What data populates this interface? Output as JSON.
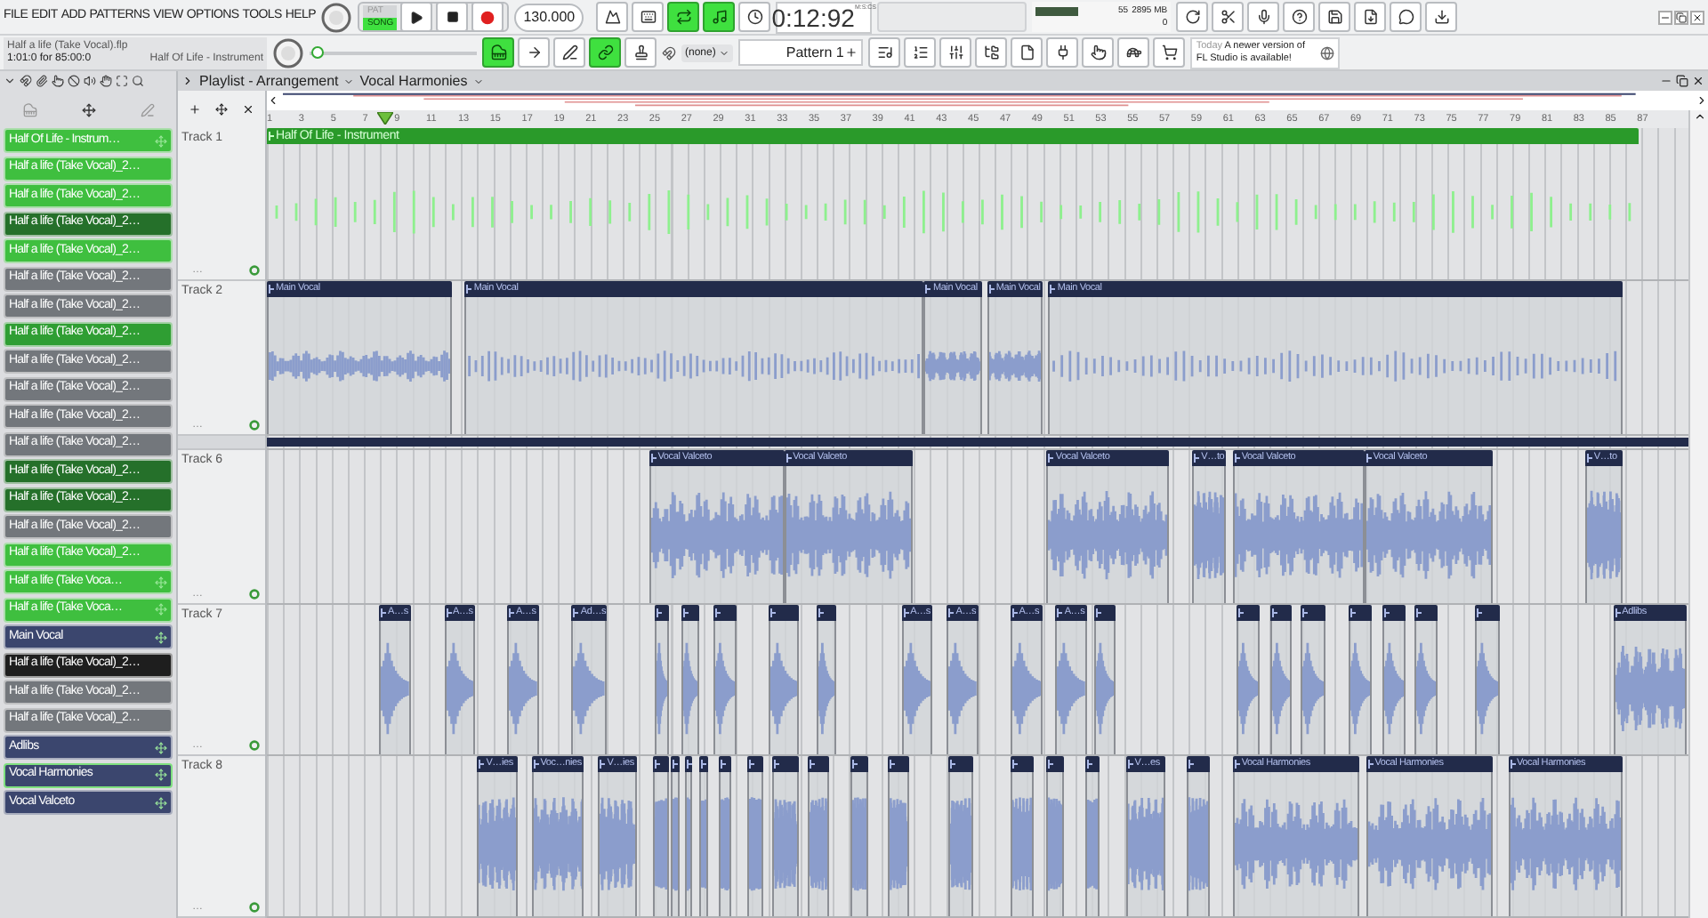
{
  "menu": [
    "FILE",
    "EDIT",
    "ADD",
    "PATTERNS",
    "VIEW",
    "OPTIONS",
    "TOOLS",
    "HELP"
  ],
  "modes": [
    {
      "label": "PAT",
      "selected": false
    },
    {
      "label": "SONG",
      "selected": true
    }
  ],
  "tempo": "130.000",
  "time": "0:12:92",
  "time_unit": "M:S:CS",
  "cpu": "55",
  "memory": "2895 MB",
  "polyphony": "0",
  "toggles_top": [
    {
      "on": false
    },
    {
      "on": false
    },
    {
      "on": true
    },
    {
      "on": true
    },
    {
      "on": false
    }
  ],
  "toggles_bottom": [
    {
      "on": true
    },
    {
      "on": false
    },
    {
      "on": false
    },
    {
      "on": true
    },
    {
      "on": false
    }
  ],
  "project": {
    "file": "Half a life (Take Vocal).flp",
    "position": "1:01:0 for 85:00:0",
    "hint": "Half Of Life - Instrument"
  },
  "position_slider": {
    "level": 0.02
  },
  "snap": "(none)",
  "pattern": "Pattern 1",
  "news": {
    "date": "Today",
    "text": "A newer version of FL Studio is available!"
  },
  "playlist": {
    "title": "Playlist - Arrangement",
    "pattern": "Vocal Harmonies"
  },
  "ruler": [
    "1",
    "3",
    "5",
    "7",
    "9",
    "11",
    "13",
    "15",
    "17",
    "19",
    "21",
    "23",
    "25",
    "27",
    "29",
    "31",
    "33",
    "35",
    "37",
    "39",
    "41",
    "43",
    "45",
    "47",
    "49",
    "51",
    "53",
    "55",
    "57",
    "59",
    "61",
    "63",
    "65",
    "67",
    "69",
    "71",
    "73",
    "75",
    "77",
    "79",
    "81",
    "83",
    "85",
    "87"
  ],
  "channels": [
    {
      "name": "Half Of Life - Instrum…",
      "color": "#3fbf3f",
      "move_icon": true,
      "selected": false
    },
    {
      "name": "Half a life (Take Vocal)_2…",
      "color": "#3fbf3f",
      "move_icon": false,
      "selected": false
    },
    {
      "name": "Half a life (Take Vocal)_2…",
      "color": "#3fbf3f",
      "move_icon": false,
      "selected": false
    },
    {
      "name": "Half a life (Take Vocal)_2…",
      "color": "#25702a",
      "move_icon": false,
      "selected": false
    },
    {
      "name": "Half a life (Take Vocal)_2…",
      "color": "#3fbf3f",
      "move_icon": false,
      "selected": false
    },
    {
      "name": "Half a life (Take Vocal)_2…",
      "color": "#73777c",
      "move_icon": false,
      "selected": false
    },
    {
      "name": "Half a life (Take Vocal)_2…",
      "color": "#73777c",
      "move_icon": false,
      "selected": false
    },
    {
      "name": "Half a life (Take Vocal)_2…",
      "color": "#2f9e33",
      "move_icon": false,
      "selected": false
    },
    {
      "name": "Half a life (Take Vocal)_2…",
      "color": "#73777c",
      "move_icon": false,
      "selected": false
    },
    {
      "name": "Half a life (Take Vocal)_2…",
      "color": "#73777c",
      "move_icon": false,
      "selected": false
    },
    {
      "name": "Half a life (Take Vocal)_2…",
      "color": "#73777c",
      "move_icon": false,
      "selected": false
    },
    {
      "name": "Half a life (Take Vocal)_2…",
      "color": "#73777c",
      "move_icon": false,
      "selected": false
    },
    {
      "name": "Half a life (Take Vocal)_2…",
      "color": "#25702a",
      "move_icon": false,
      "selected": false
    },
    {
      "name": "Half a life (Take Vocal)_2…",
      "color": "#25702a",
      "move_icon": false,
      "selected": false
    },
    {
      "name": "Half a life (Take Vocal)_2…",
      "color": "#73777c",
      "move_icon": false,
      "selected": false
    },
    {
      "name": "Half a life (Take Vocal)_2…",
      "color": "#3fbf3f",
      "move_icon": false,
      "selected": false
    },
    {
      "name": "Half a life (Take Voca…",
      "color": "#3fbf3f",
      "move_icon": true,
      "selected": false
    },
    {
      "name": "Half a life (Take Voca…",
      "color": "#3fbf3f",
      "move_icon": true,
      "selected": false
    },
    {
      "name": "Main Vocal",
      "color": "#3b466e",
      "move_icon": true,
      "selected": false
    },
    {
      "name": "Half a life (Take Vocal)_2…",
      "color": "#1e1e1e",
      "move_icon": false,
      "selected": false
    },
    {
      "name": "Half a life (Take Vocal)_2…",
      "color": "#73777c",
      "move_icon": false,
      "selected": false
    },
    {
      "name": "Half a life (Take Vocal)_2…",
      "color": "#73777c",
      "move_icon": false,
      "selected": false
    },
    {
      "name": "Adlibs",
      "color": "#3b466e",
      "move_icon": true,
      "selected": false
    },
    {
      "name": "Vocal Harmonies",
      "color": "#3b466e",
      "move_icon": true,
      "selected": true
    },
    {
      "name": "Vocal Valceto",
      "color": "#3b466e",
      "move_icon": true,
      "selected": false
    }
  ],
  "tracks": [
    {
      "kind": "track",
      "name": "Track 1",
      "more": "…",
      "color": "#2a9a2a",
      "clips": [
        {
          "kind": "named",
          "label": "Half Of Life - Instrument"
        }
      ]
    },
    {
      "kind": "track",
      "name": "Track 2",
      "more": "…",
      "color": "#222b4a",
      "clips": [
        {
          "kind": "named",
          "label": "Main Vocal"
        },
        {
          "kind": "named",
          "label": "Main Vocal"
        },
        {
          "kind": "named",
          "label": "Main Vocal"
        },
        {
          "kind": "named",
          "label": "Main Vocal"
        },
        {
          "kind": "named",
          "label": "Main Vocal"
        }
      ]
    },
    {
      "kind": "collapsed",
      "color": "#222b4a"
    },
    {
      "kind": "track",
      "name": "Track 6",
      "more": "…",
      "color": "#222b4a",
      "clips": [
        {
          "kind": "named",
          "label": "Vocal Valceto"
        },
        {
          "kind": "named",
          "label": "Vocal Valceto"
        },
        {
          "kind": "named",
          "label": "Vocal Valceto"
        },
        {
          "kind": "named",
          "label": "V…to"
        },
        {
          "kind": "named",
          "label": "Vocal Valceto"
        },
        {
          "kind": "named",
          "label": "Vocal Valceto"
        },
        {
          "kind": "named",
          "label": "V…to"
        }
      ]
    },
    {
      "kind": "track",
      "name": "Track 7",
      "more": "…",
      "color": "#222b4a",
      "clips": [
        {
          "kind": "named",
          "label": "A…s"
        },
        {
          "kind": "named",
          "label": "A…s"
        },
        {
          "kind": "named",
          "label": "A…s"
        },
        {
          "kind": "named",
          "label": "Ad…s"
        },
        {
          "kind": "plain"
        },
        {
          "kind": "plain"
        },
        {
          "kind": "plain"
        },
        {
          "kind": "plain"
        },
        {
          "kind": "plain"
        },
        {
          "kind": "named",
          "label": "A…s"
        },
        {
          "kind": "named",
          "label": "A…s"
        },
        {
          "kind": "named",
          "label": "A…s"
        },
        {
          "kind": "named",
          "label": "A…s"
        },
        {
          "kind": "plain"
        },
        {
          "kind": "plain"
        },
        {
          "kind": "plain"
        },
        {
          "kind": "plain"
        },
        {
          "kind": "plain"
        },
        {
          "kind": "plain"
        },
        {
          "kind": "plain"
        },
        {
          "kind": "plain"
        },
        {
          "kind": "named",
          "label": "Adlibs"
        }
      ]
    },
    {
      "kind": "track",
      "name": "Track 8",
      "more": "…",
      "color": "#222b4a",
      "clips": [
        {
          "kind": "named",
          "label": "V…ies"
        },
        {
          "kind": "named",
          "label": "Voc…nies"
        },
        {
          "kind": "named",
          "label": "V…ies"
        },
        {
          "kind": "plain"
        },
        {
          "kind": "plain"
        },
        {
          "kind": "plain"
        },
        {
          "kind": "plain"
        },
        {
          "kind": "plain"
        },
        {
          "kind": "plain"
        },
        {
          "kind": "plain"
        },
        {
          "kind": "plain"
        },
        {
          "kind": "plain"
        },
        {
          "kind": "plain"
        },
        {
          "kind": "plain"
        },
        {
          "kind": "plain"
        },
        {
          "kind": "plain"
        },
        {
          "kind": "plain"
        },
        {
          "kind": "named",
          "label": "V…es"
        },
        {
          "kind": "plain"
        },
        {
          "kind": "named",
          "label": "Vocal Harmonies"
        },
        {
          "kind": "named",
          "label": "Vocal Harmonies"
        },
        {
          "kind": "named",
          "label": "Vocal Harmonies"
        }
      ]
    }
  ]
}
